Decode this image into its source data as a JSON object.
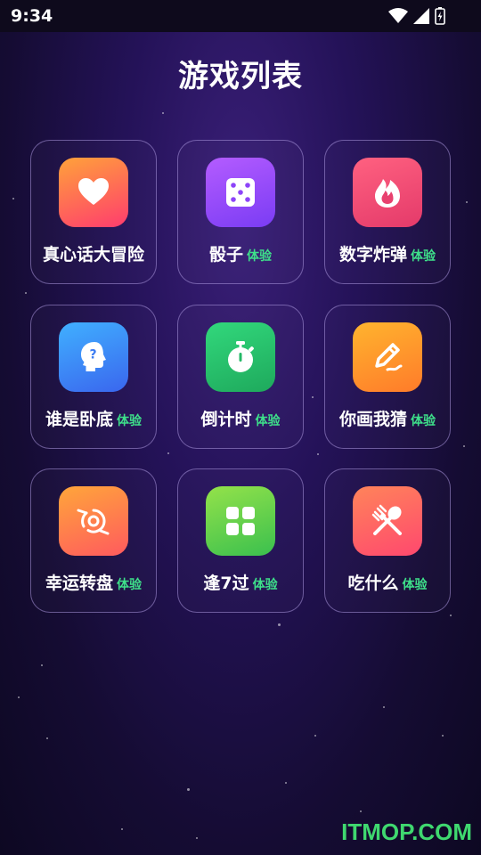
{
  "status_bar": {
    "time": "9:34"
  },
  "page": {
    "title": "游戏列表"
  },
  "games": [
    {
      "label": "真心话大冒险",
      "tag": "",
      "icon": "heart-icon",
      "colors": [
        "#ff9a3c",
        "#ff3d6e"
      ]
    },
    {
      "label": "骰子",
      "tag": "体验",
      "icon": "dice-icon",
      "colors": [
        "#b45cff",
        "#7b3df5"
      ]
    },
    {
      "label": "数字炸弹",
      "tag": "体验",
      "icon": "flame-icon",
      "colors": [
        "#ff5a7a",
        "#e63d6c"
      ]
    },
    {
      "label": "谁是卧底",
      "tag": "体验",
      "icon": "head-question-icon",
      "colors": [
        "#3fa8ff",
        "#3a6cf0"
      ]
    },
    {
      "label": "倒计时",
      "tag": "体验",
      "icon": "stopwatch-icon",
      "colors": [
        "#2fd67a",
        "#1eaa5c"
      ]
    },
    {
      "label": "你画我猜",
      "tag": "体验",
      "icon": "pen-icon",
      "colors": [
        "#ffb030",
        "#ff7a2a"
      ]
    },
    {
      "label": "幸运转盘",
      "tag": "体验",
      "icon": "wheel-icon",
      "colors": [
        "#ffa03a",
        "#ff5e5e"
      ]
    },
    {
      "label": "逢7过",
      "tag": "体验",
      "icon": "grid-icon",
      "colors": [
        "#8fe04a",
        "#3cc24e"
      ]
    },
    {
      "label": "吃什么",
      "tag": "体验",
      "icon": "utensils-icon",
      "colors": [
        "#ff7e5a",
        "#ff4d6d"
      ]
    }
  ],
  "watermark": "ITMOP.COM"
}
